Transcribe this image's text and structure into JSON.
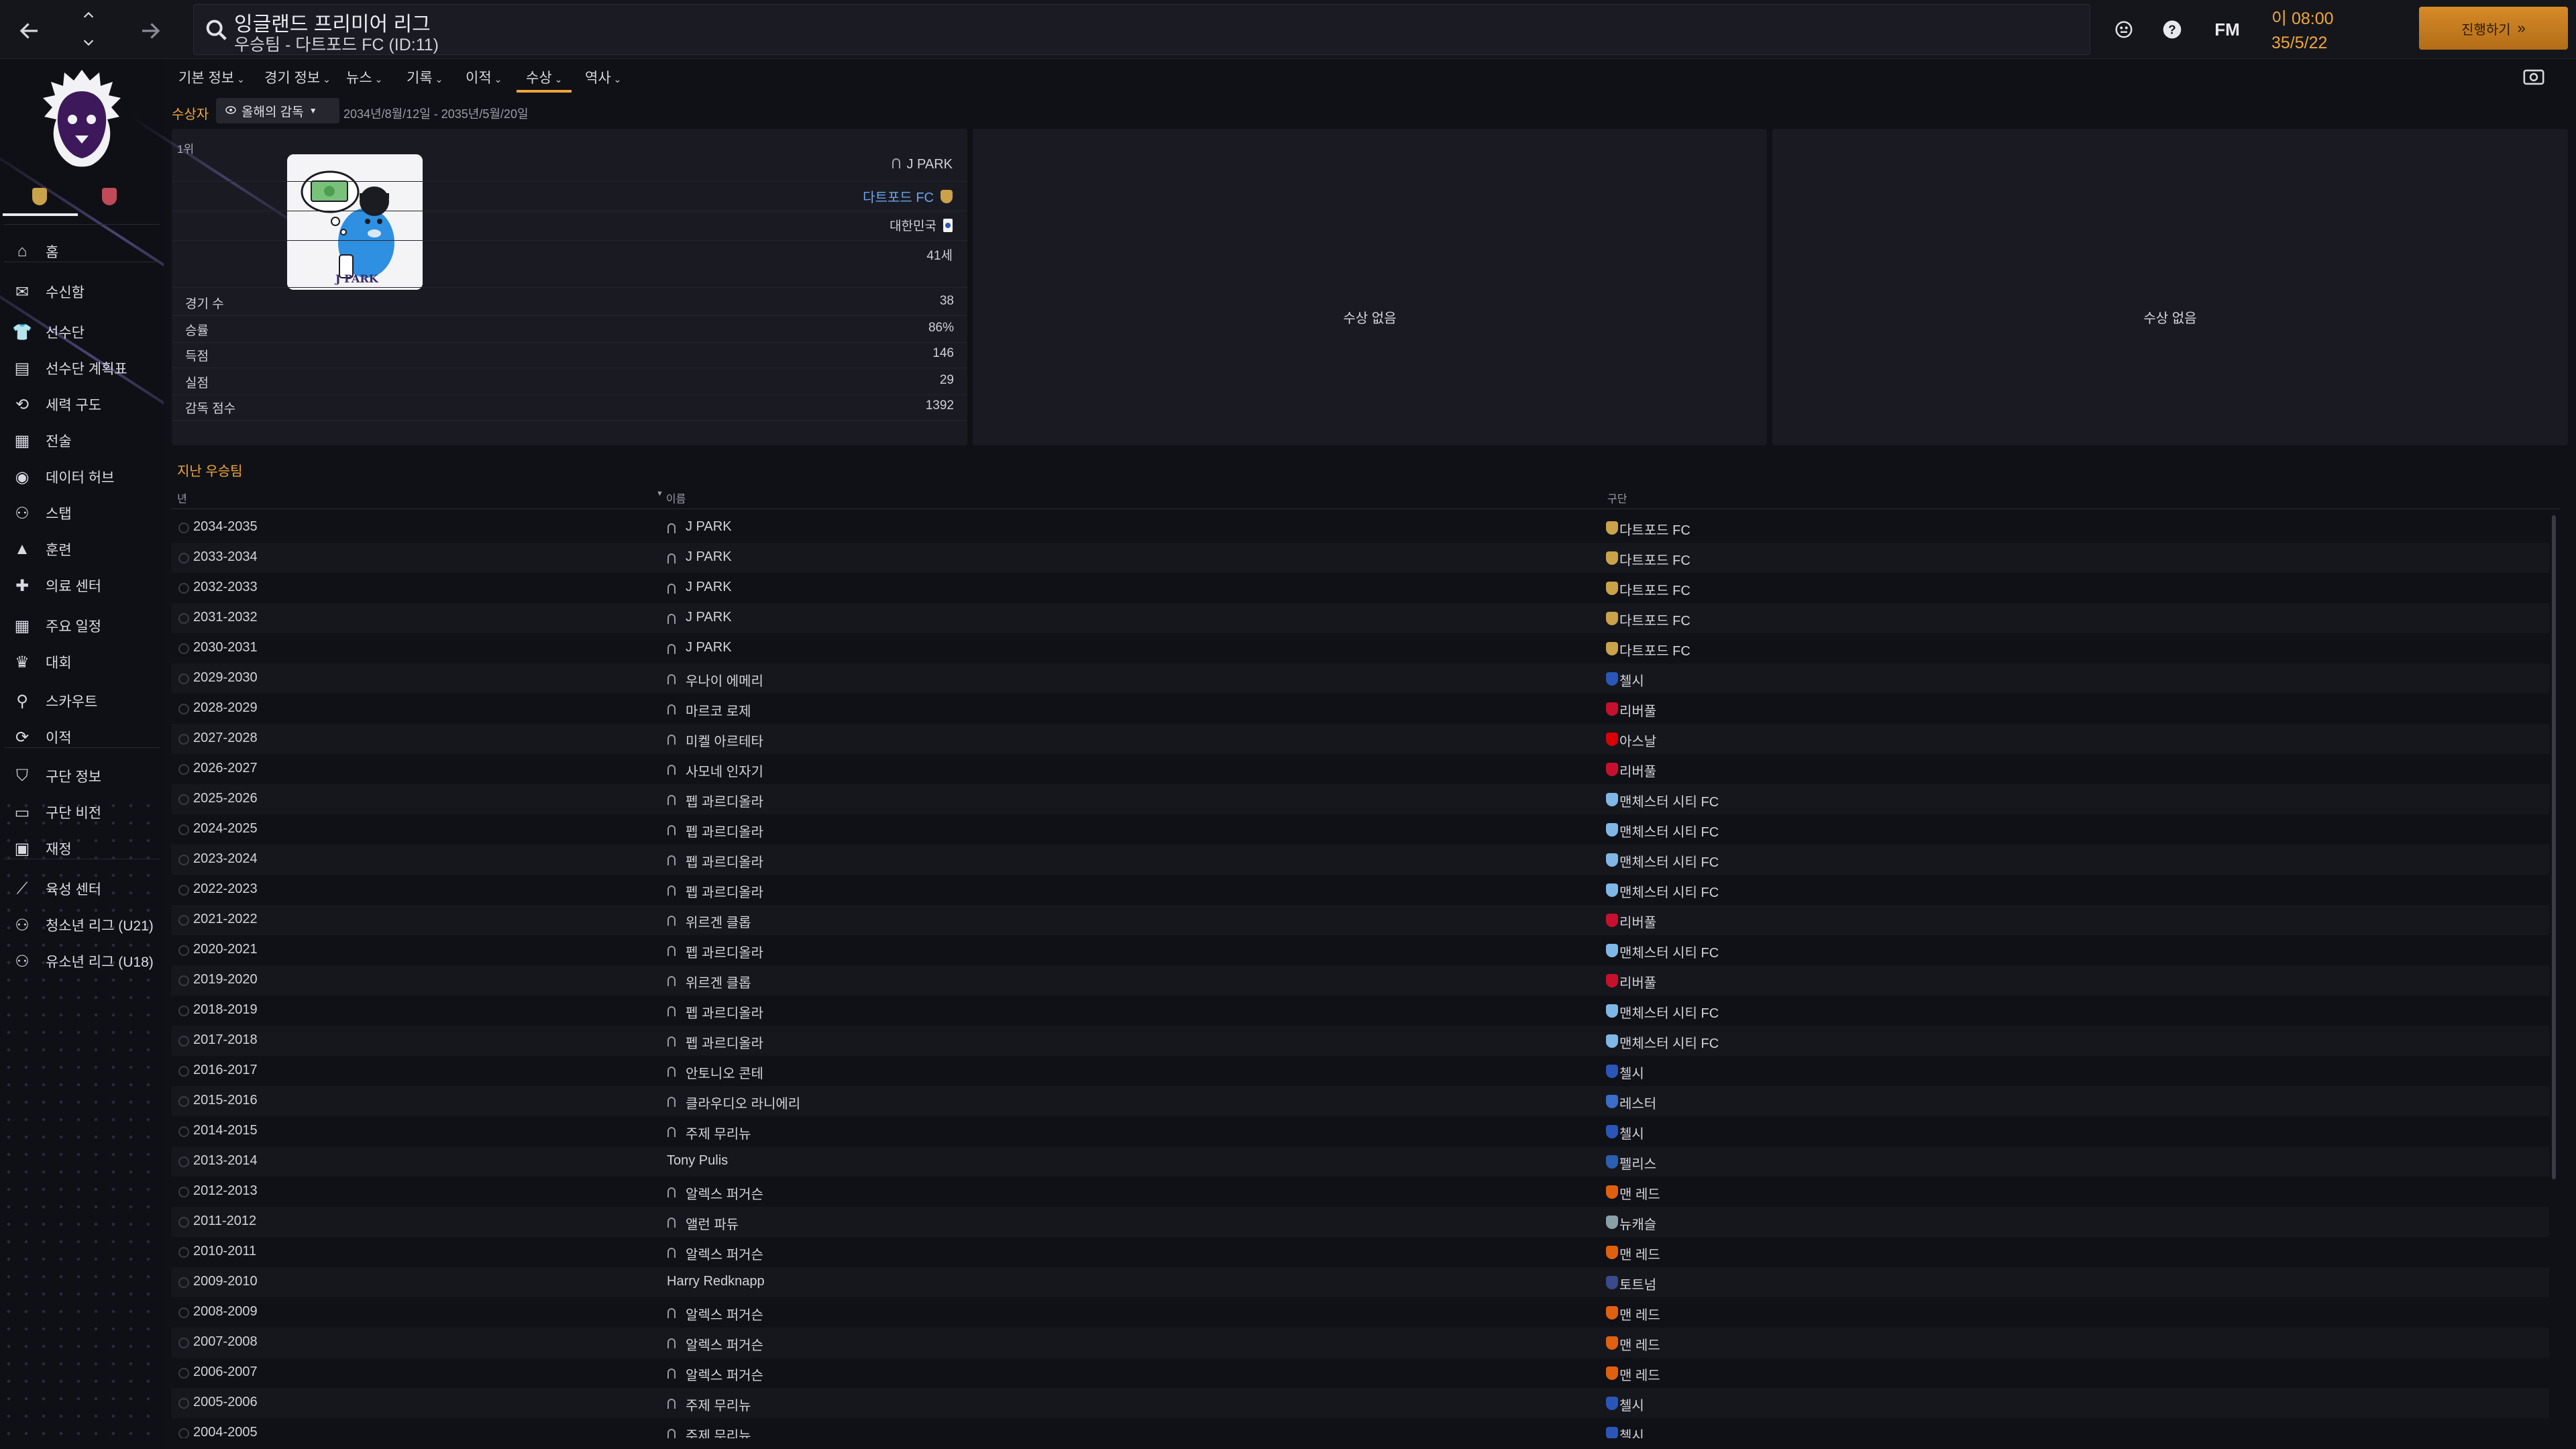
{
  "topbar": {
    "title": "잉글랜드 프리미어 리그",
    "subtitle": "우승팀 - 다트포드 FC (ID:11)",
    "fm_label": "FM",
    "clock_time": "이 08:00",
    "clock_date": "35/5/22",
    "continue_label": "진행하기"
  },
  "sidebar": {
    "items": [
      {
        "label": "홈",
        "icon": "home-icon"
      },
      {
        "label": "수신함",
        "icon": "inbox-icon"
      },
      {
        "label": "선수단",
        "icon": "shirt-icon"
      },
      {
        "label": "선수단 계획표",
        "icon": "clipboard-icon"
      },
      {
        "label": "세력 구도",
        "icon": "hierarchy-icon"
      },
      {
        "label": "전술",
        "icon": "tactics-icon"
      },
      {
        "label": "데이터 허브",
        "icon": "data-hub-icon"
      },
      {
        "label": "스탭",
        "icon": "staff-icon"
      },
      {
        "label": "훈련",
        "icon": "training-icon"
      },
      {
        "label": "의료 센터",
        "icon": "medical-icon"
      },
      {
        "label": "주요 일정",
        "icon": "calendar-icon"
      },
      {
        "label": "대회",
        "icon": "trophy-icon"
      },
      {
        "label": "스카우트",
        "icon": "scout-icon"
      },
      {
        "label": "이적",
        "icon": "transfer-icon"
      },
      {
        "label": "구단 정보",
        "icon": "club-shield-icon"
      },
      {
        "label": "구단 비전",
        "icon": "vision-icon"
      },
      {
        "label": "재정",
        "icon": "finance-icon"
      },
      {
        "label": "육성 센터",
        "icon": "development-icon"
      },
      {
        "label": "청소년 리그 (U21)",
        "icon": "u21-icon"
      },
      {
        "label": "유소년 리그 (U18)",
        "icon": "u18-icon"
      }
    ]
  },
  "subnav": {
    "tabs": [
      "기본 정보",
      "경기 정보",
      "뉴스",
      "기록",
      "이적",
      "수상",
      "역사"
    ],
    "active": "수상"
  },
  "filter": {
    "label": "수상자",
    "dropdown": "올해의 감독",
    "period": "2034년/8월/12일 - 2035년/5월/20일"
  },
  "winner": {
    "rank": "1위",
    "name": "J PARK",
    "club": "다트포드 FC",
    "nation": "대한민국",
    "age": "41세",
    "stats": [
      {
        "label": "경기 수",
        "value": "38"
      },
      {
        "label": "승률",
        "value": "86%"
      },
      {
        "label": "득점",
        "value": "146"
      },
      {
        "label": "실점",
        "value": "29"
      },
      {
        "label": "감독 점수",
        "value": "1392"
      }
    ],
    "photo_caption": "J PARK"
  },
  "empty_slots": {
    "second": "수상 없음",
    "third": "수상 없음"
  },
  "history": {
    "title": "지난 우승팀",
    "columns": {
      "year": "년",
      "name": "이름",
      "club": "구단"
    },
    "rows": [
      {
        "year": "2034-2035",
        "name": "J PARK",
        "club": "다트포드 FC",
        "crest": "#c9a24a",
        "link": true,
        "icon": true
      },
      {
        "year": "2033-2034",
        "name": "J PARK",
        "club": "다트포드 FC",
        "crest": "#c9a24a",
        "link": true,
        "icon": true
      },
      {
        "year": "2032-2033",
        "name": "J PARK",
        "club": "다트포드 FC",
        "crest": "#c9a24a",
        "link": true,
        "icon": true
      },
      {
        "year": "2031-2032",
        "name": "J PARK",
        "club": "다트포드 FC",
        "crest": "#c9a24a",
        "link": true,
        "icon": true
      },
      {
        "year": "2030-2031",
        "name": "J PARK",
        "club": "다트포드 FC",
        "crest": "#c9a24a",
        "link": true,
        "icon": true
      },
      {
        "year": "2029-2030",
        "name": "우나이 에메리",
        "club": "첼시",
        "crest": "#2a56b8",
        "link": false,
        "icon": true
      },
      {
        "year": "2028-2029",
        "name": "마르코 로제",
        "club": "리버풀",
        "crest": "#c8102e",
        "link": false,
        "icon": true
      },
      {
        "year": "2027-2028",
        "name": "미켈 아르테타",
        "club": "아스날",
        "crest": "#db0007",
        "link": false,
        "icon": true
      },
      {
        "year": "2026-2027",
        "name": "사모네 인자기",
        "club": "리버풀",
        "crest": "#c8102e",
        "link": false,
        "icon": true
      },
      {
        "year": "2025-2026",
        "name": "펩 과르디올라",
        "club": "맨체스터 시티 FC",
        "crest": "#7fb8e6",
        "link": false,
        "icon": true
      },
      {
        "year": "2024-2025",
        "name": "펩 과르디올라",
        "club": "맨체스터 시티 FC",
        "crest": "#7fb8e6",
        "link": false,
        "icon": true
      },
      {
        "year": "2023-2024",
        "name": "펩 과르디올라",
        "club": "맨체스터 시티 FC",
        "crest": "#7fb8e6",
        "link": false,
        "icon": true
      },
      {
        "year": "2022-2023",
        "name": "펩 과르디올라",
        "club": "맨체스터 시티 FC",
        "crest": "#7fb8e6",
        "link": false,
        "icon": true
      },
      {
        "year": "2021-2022",
        "name": "위르겐 클롭",
        "club": "리버풀",
        "crest": "#c8102e",
        "link": false,
        "icon": true
      },
      {
        "year": "2020-2021",
        "name": "펩 과르디올라",
        "club": "맨체스터 시티 FC",
        "crest": "#7fb8e6",
        "link": false,
        "icon": true
      },
      {
        "year": "2019-2020",
        "name": "위르겐 클롭",
        "club": "리버풀",
        "crest": "#c8102e",
        "link": false,
        "icon": true
      },
      {
        "year": "2018-2019",
        "name": "펩 과르디올라",
        "club": "맨체스터 시티 FC",
        "crest": "#7fb8e6",
        "link": false,
        "icon": true
      },
      {
        "year": "2017-2018",
        "name": "펩 과르디올라",
        "club": "맨체스터 시티 FC",
        "crest": "#7fb8e6",
        "link": false,
        "icon": true
      },
      {
        "year": "2016-2017",
        "name": "안토니오 콘테",
        "club": "첼시",
        "crest": "#2a56b8",
        "link": false,
        "icon": true
      },
      {
        "year": "2015-2016",
        "name": "클라우디오 라니에리",
        "club": "레스터",
        "crest": "#3a6ec8",
        "link": false,
        "icon": true
      },
      {
        "year": "2014-2015",
        "name": "주제 무리뉴",
        "club": "첼시",
        "crest": "#2a56b8",
        "link": false,
        "icon": true
      },
      {
        "year": "2013-2014",
        "name": "Tony Pulis",
        "club": "펠리스",
        "crest": "#2b5fb0",
        "link": false,
        "icon": false
      },
      {
        "year": "2012-2013",
        "name": "알렉스 퍼거슨",
        "club": "맨 레드",
        "crest": "#e06010",
        "link": false,
        "icon": true
      },
      {
        "year": "2011-2012",
        "name": "앨런 파듀",
        "club": "뉴캐슬",
        "crest": "#8aa0a8",
        "link": false,
        "icon": true
      },
      {
        "year": "2010-2011",
        "name": "알렉스 퍼거슨",
        "club": "맨 레드",
        "crest": "#e06010",
        "link": false,
        "icon": true
      },
      {
        "year": "2009-2010",
        "name": "Harry Redknapp",
        "club": "토트넘",
        "crest": "#3a4a8a",
        "link": false,
        "icon": false
      },
      {
        "year": "2008-2009",
        "name": "알렉스 퍼거슨",
        "club": "맨 레드",
        "crest": "#e06010",
        "link": false,
        "icon": true
      },
      {
        "year": "2007-2008",
        "name": "알렉스 퍼거슨",
        "club": "맨 레드",
        "crest": "#e06010",
        "link": false,
        "icon": true
      },
      {
        "year": "2006-2007",
        "name": "알렉스 퍼거슨",
        "club": "맨 레드",
        "crest": "#e06010",
        "link": false,
        "icon": true
      },
      {
        "year": "2005-2006",
        "name": "주제 무리뉴",
        "club": "첼시",
        "crest": "#2a56b8",
        "link": false,
        "icon": true
      },
      {
        "year": "2004-2005",
        "name": "주제 무리뉴",
        "club": "첼시",
        "crest": "#2a56b8",
        "link": false,
        "icon": true
      }
    ]
  },
  "colors": {
    "accent": "#f0a63a",
    "link": "#6aa4f0",
    "panel": "#1a1b22",
    "background": "#101116",
    "league_purple": "#5a1f8c"
  }
}
